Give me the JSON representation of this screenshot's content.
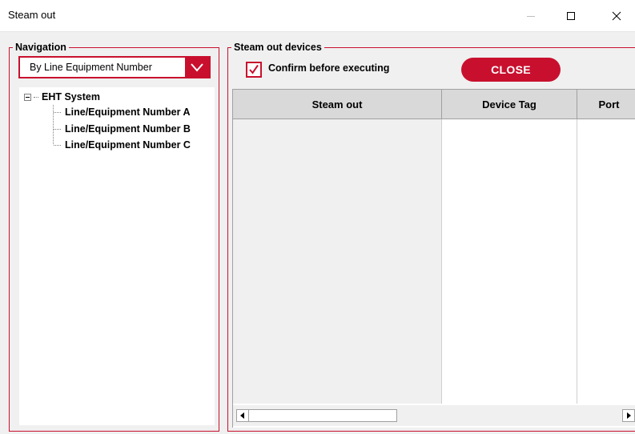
{
  "window": {
    "title": "Steam out",
    "controls": {
      "minimize_icon": "minimize-icon",
      "maximize_icon": "maximize-icon",
      "close_icon": "close-icon"
    }
  },
  "colors": {
    "accent": "#c8102e",
    "header_bg": "#d9d9d9",
    "panel_bg": "#f0f0f0"
  },
  "navigation": {
    "legend": "Navigation",
    "dropdown": {
      "selected": "By Line Equipment Number",
      "arrow_icon": "chevron-down-icon"
    },
    "tree": {
      "root": "EHT System",
      "children": [
        "Line/Equipment Number A",
        "Line/Equipment Number B",
        "Line/Equipment Number C"
      ]
    }
  },
  "devices": {
    "legend": "Steam out devices",
    "confirm_label": "Confirm before executing",
    "confirm_checked": true,
    "close_label": "CLOSE",
    "columns": [
      "Steam out",
      "Device Tag",
      "Port"
    ],
    "rows": []
  }
}
